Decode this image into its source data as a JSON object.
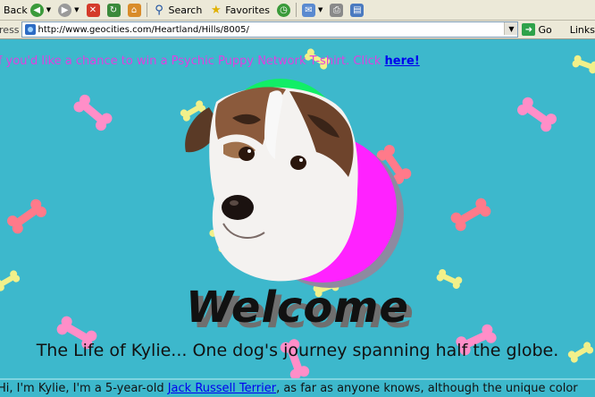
{
  "toolbar": {
    "back_label": "Back",
    "search_label": "Search",
    "favorites_label": "Favorites"
  },
  "address_bar": {
    "label": "Address",
    "url": "http://www.geocities.com/Heartland/Hills/8005/",
    "go_label": "Go",
    "links_label": "Links"
  },
  "page": {
    "promo_text": "If you'd like a chance to win a Psychic Puppy Network T-shirt. Click",
    "promo_link": "here!",
    "welcome": "Welcome",
    "tagline": "The Life of Kylie... One dog's journey spanning half the globe.",
    "intro_text_before": "Hi, I'm Kylie, I'm a 5-year-old",
    "intro_link": "Jack Russell Terrier",
    "intro_text_after": ", as far as anyone knows, although the unique color"
  },
  "colors": {
    "page_background": "#3db8cc",
    "promo_text": "#e040e0",
    "link": "#0000ee",
    "circle_green": "#11ee66",
    "circle_pink": "#ff22ff"
  }
}
